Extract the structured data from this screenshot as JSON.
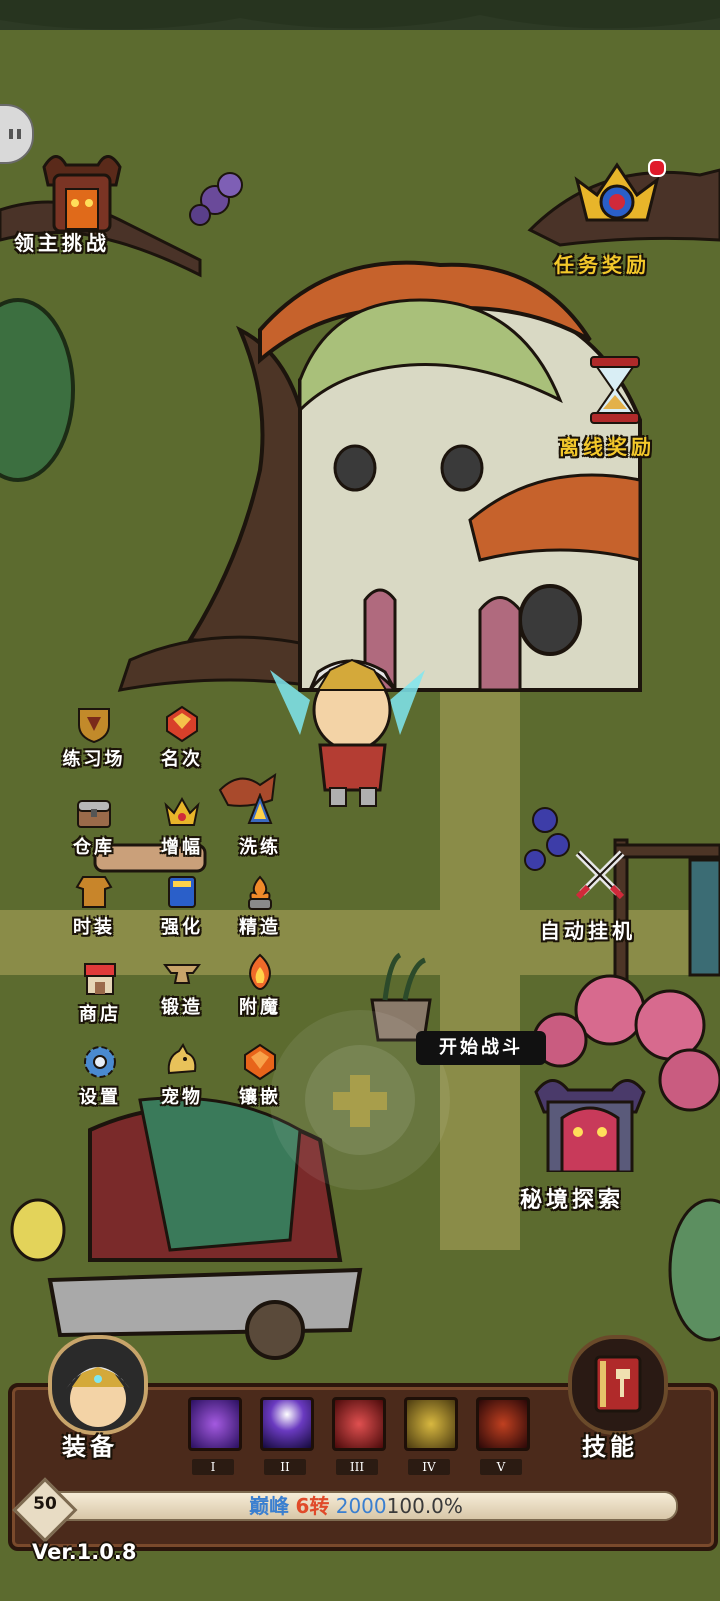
{
  "top_left": {
    "boss_challenge": "领主挑战"
  },
  "top_right": {
    "task_reward": "任务奖励",
    "offline_reward": "离线奖励"
  },
  "menu": [
    {
      "label": "练习场",
      "icon": "shield-icon"
    },
    {
      "label": "名次",
      "icon": "ruby-icon"
    },
    {
      "label": "仓库",
      "icon": "chest-icon"
    },
    {
      "label": "增幅",
      "icon": "crown-icon"
    },
    {
      "label": "洗练",
      "icon": "crystal-icon"
    },
    {
      "label": "时装",
      "icon": "armor-icon"
    },
    {
      "label": "强化",
      "icon": "book-icon"
    },
    {
      "label": "精造",
      "icon": "brazier-icon"
    },
    {
      "label": "商店",
      "icon": "shop-icon"
    },
    {
      "label": "锻造",
      "icon": "anvil-icon"
    },
    {
      "label": "附魔",
      "icon": "fire-icon"
    },
    {
      "label": "设置",
      "icon": "gear-icon"
    },
    {
      "label": "宠物",
      "icon": "dragon-icon"
    },
    {
      "label": "镶嵌",
      "icon": "gem-icon"
    }
  ],
  "auto_idle": "自动挂机",
  "start_battle": "开始战斗",
  "secret_explore": "秘境探索",
  "bottom": {
    "equipment": "装备",
    "skills_label": "技能",
    "skill_slots": [
      "I",
      "II",
      "III",
      "IV",
      "V"
    ],
    "level": "50",
    "rank_prefix": "巅峰",
    "rebirth": "6转",
    "points": "2000",
    "percent": "100.0%",
    "progress": 1.0,
    "version": "Ver.1.0.8"
  },
  "colors": {
    "gold": "#f3c82b",
    "panel": "#4b2a1b",
    "rebirth": "#e04a2a",
    "points": "#3a7fd0"
  }
}
